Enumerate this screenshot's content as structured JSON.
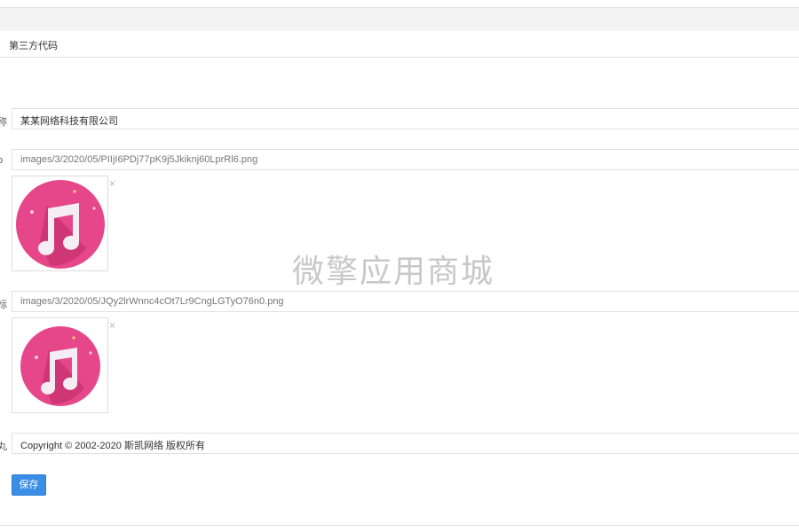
{
  "panel": {
    "title": "第三方代码"
  },
  "fields": [
    {
      "edge_label": "称",
      "value": "某某网络科技有限公司"
    },
    {
      "edge_label": "o",
      "value": "images/3/2020/05/PIIjI6PDj77pK9j5Jkiknj60LprRl6.png"
    },
    {
      "edge_label": "标",
      "value": "images/3/2020/05/JQy2lrWnnc4cOt7Lr9CngLGTyO76n0.png"
    },
    {
      "edge_label": "丸",
      "value": "Copyright © 2002-2020 斯凯网络 版权所有"
    }
  ],
  "image_remove_symbol": "×",
  "image_icon": "music-note-icon",
  "watermark": "微擎应用商城",
  "actions": {
    "save_label": "保存"
  },
  "colors": {
    "primary_button": "#3a8ee6",
    "icon_pink": "#e6478a",
    "icon_shadow": "#c7306f",
    "note_white": "#f4eef4"
  }
}
